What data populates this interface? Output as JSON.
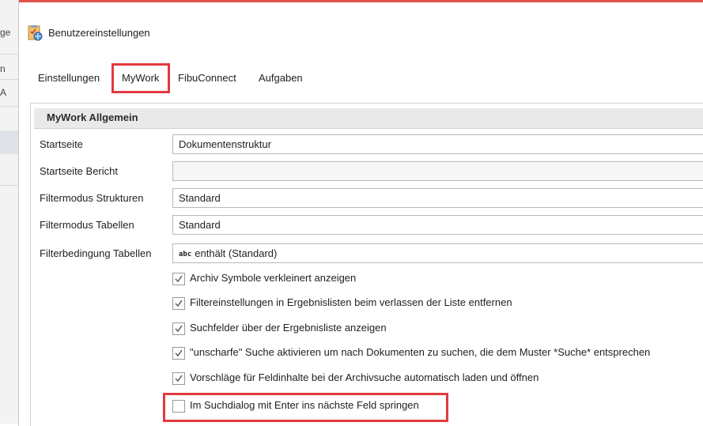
{
  "background_fragments": [
    "ge",
    "n",
    "A"
  ],
  "dialog": {
    "title": "Benutzereinstellungen",
    "icon": "user-settings-icon"
  },
  "tabs": [
    {
      "label": "Einstellungen"
    },
    {
      "label": "MyWork",
      "active": true
    },
    {
      "label": "FibuConnect"
    },
    {
      "label": "Aufgaben"
    }
  ],
  "group": {
    "title": "MyWork Allgemein"
  },
  "fields": [
    {
      "label": "Startseite",
      "value": "Dokumentenstruktur"
    },
    {
      "label": "Startseite Bericht",
      "value": ""
    },
    {
      "label": "Filtermodus Strukturen",
      "value": "Standard"
    },
    {
      "label": "Filtermodus Tabellen",
      "value": "Standard"
    },
    {
      "label": "Filterbedingung Tabellen",
      "value": "enthält (Standard)",
      "prefix": "abc"
    }
  ],
  "checkboxes": [
    {
      "label": "Archiv Symbole verkleinert anzeigen",
      "checked": true
    },
    {
      "label": "Filtereinstellungen in Ergebnislisten beim verlassen der Liste entfernen",
      "checked": true
    },
    {
      "label": "Suchfelder über der Ergebnisliste anzeigen",
      "checked": true
    },
    {
      "label": "\"unscharfe\" Suche aktivieren um nach Dokumenten zu suchen, die dem Muster *Suche* entsprechen",
      "checked": true
    },
    {
      "label": "Vorschläge für Feldinhalte bei der Archivsuche automatisch laden und öffnen",
      "checked": true
    },
    {
      "label": "Im Suchdialog mit Enter ins nächste Feld springen",
      "checked": false
    }
  ],
  "colors": {
    "highlight": "#e23a3f",
    "title_border": "#e0534a"
  }
}
